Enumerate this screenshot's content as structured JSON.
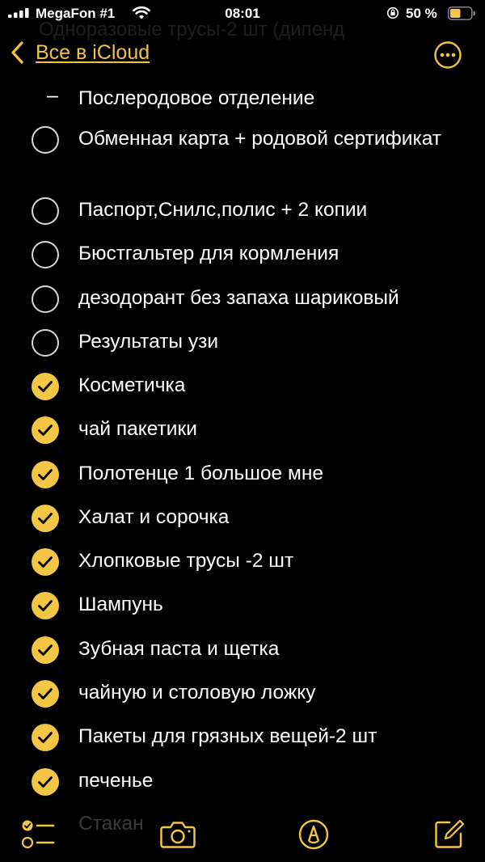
{
  "status_bar": {
    "carrier": "MegaFon #1",
    "time": "08:01",
    "battery": "50 %",
    "battery_level": 0.5,
    "accent": "#f4c646"
  },
  "scrolled_title": "Одноразовые трусы-2 шт (дипенд",
  "nav": {
    "back_label": "Все в iCloud",
    "back_icon": "chevron-left-icon",
    "more_icon": "ellipsis-circle-icon"
  },
  "checklist": {
    "header_item": "Послеродовое отделение",
    "items": [
      {
        "text": "Обменная карта + родовой сертификат",
        "checked": false
      },
      {
        "text": "Паспорт,Снилс,полис + 2 копии",
        "checked": false
      },
      {
        "text": "Бюстгальтер для кормления",
        "checked": false
      },
      {
        "text": "дезодорант без запаха шариковый",
        "checked": false
      },
      {
        "text": "Результаты узи",
        "checked": false
      },
      {
        "text": "Косметичка",
        "checked": true
      },
      {
        "text": "чай пакетики",
        "checked": true
      },
      {
        "text": "Полотенце 1 большое мне",
        "checked": true
      },
      {
        "text": "Халат и сорочка",
        "checked": true
      },
      {
        "text": "Хлопковые трусы -2 шт",
        "checked": true
      },
      {
        "text": "Шампунь",
        "checked": true
      },
      {
        "text": "Зубная паста и щетка",
        "checked": true
      },
      {
        "text": "чайную и столовую ложку",
        "checked": true
      },
      {
        "text": "Пакеты для грязных вещей-2 шт",
        "checked": true
      },
      {
        "text": "печенье",
        "checked": true
      }
    ],
    "faded_next_item": "Стакан"
  },
  "toolbar": {
    "icons": [
      "checklist-icon",
      "camera-icon",
      "markup-pen-icon",
      "compose-icon"
    ]
  }
}
